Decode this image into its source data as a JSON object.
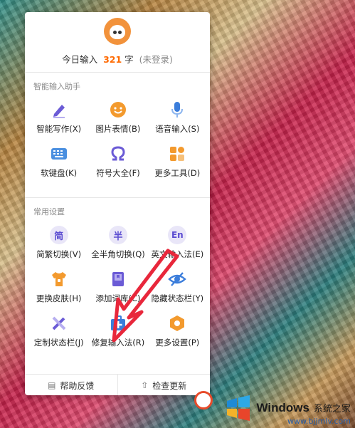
{
  "header": {
    "count_prefix": "今日输入",
    "count_value": "321",
    "count_unit": "字",
    "login_status": "(未登录)"
  },
  "sections": {
    "assistant_title": "智能输入助手",
    "common_title": "常用设置"
  },
  "assistant_items": [
    {
      "label": "智能写作(X)",
      "icon": "pen-icon"
    },
    {
      "label": "图片表情(B)",
      "icon": "smiley-icon"
    },
    {
      "label": "语音输入(S)",
      "icon": "microphone-icon"
    },
    {
      "label": "软键盘(K)",
      "icon": "keyboard-icon"
    },
    {
      "label": "符号大全(F)",
      "icon": "omega-icon"
    },
    {
      "label": "更多工具(D)",
      "icon": "grid-tools-icon"
    }
  ],
  "common_items": [
    {
      "label": "简繁切换(V)",
      "icon_text": "简",
      "icon": "simplified-traditional-icon"
    },
    {
      "label": "全半角切换(Q)",
      "icon_text": "半",
      "icon": "half-width-icon"
    },
    {
      "label": "英文输入法(E)",
      "icon_text": "En",
      "icon": "english-icon"
    },
    {
      "label": "更换皮肤(H)",
      "icon": "shirt-icon"
    },
    {
      "label": "添加词库(C)",
      "icon": "book-icon"
    },
    {
      "label": "隐藏状态栏(Y)",
      "icon": "eye-hidden-icon"
    },
    {
      "label": "定制状态栏(J)",
      "icon": "tools-icon"
    },
    {
      "label": "修复输入法(R)",
      "icon": "repair-kit-icon"
    },
    {
      "label": "更多设置(P)",
      "icon": "hexagon-settings-icon"
    }
  ],
  "footer": {
    "feedback_label": "帮助反馈",
    "update_label": "检查更新"
  },
  "watermark": {
    "brand": "Windows",
    "suffix": "系统之家",
    "url": "www.bjjmlv.com"
  },
  "colors": {
    "accent_orange": "#ff6a00",
    "icon_purple": "#6b5bd6",
    "icon_blue": "#3b7ddb",
    "arrow_red": "#e8273b"
  }
}
